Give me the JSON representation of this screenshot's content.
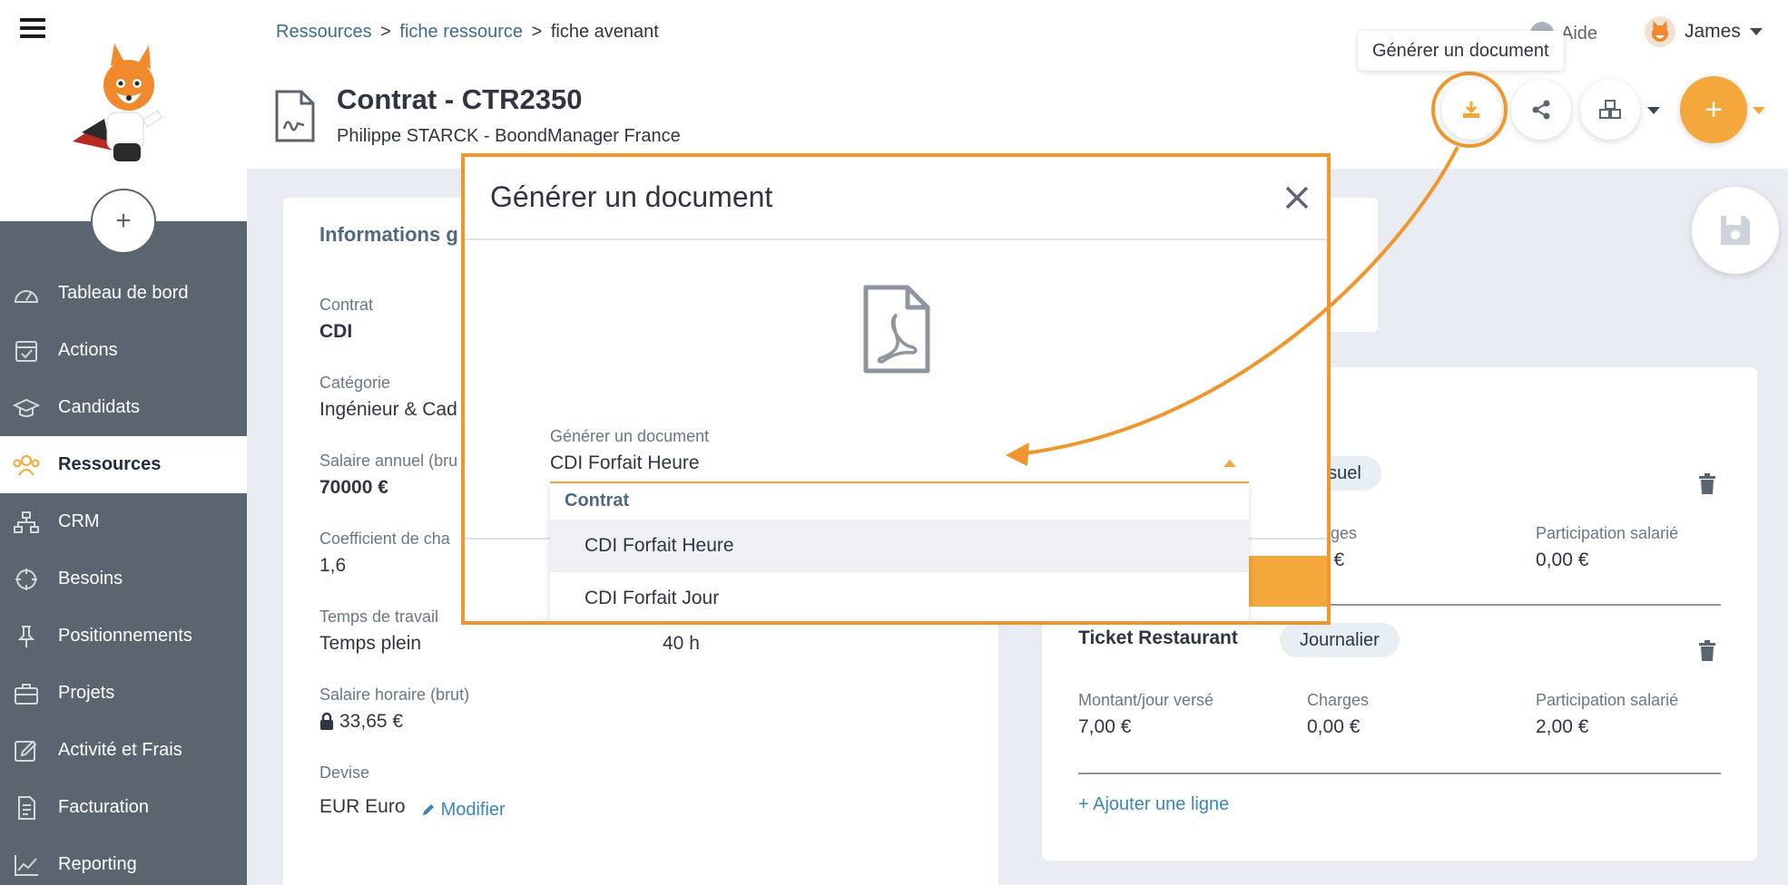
{
  "sidebar": {
    "items": [
      {
        "label": "Tableau de bord",
        "icon": "dashboard-icon"
      },
      {
        "label": "Actions",
        "icon": "calendar-check-icon"
      },
      {
        "label": "Candidats",
        "icon": "graduation-cap-icon"
      },
      {
        "label": "Ressources",
        "icon": "users-icon",
        "active": true
      },
      {
        "label": "CRM",
        "icon": "sitemap-icon"
      },
      {
        "label": "Besoins",
        "icon": "crosshair-icon"
      },
      {
        "label": "Positionnements",
        "icon": "pin-icon"
      },
      {
        "label": "Projets",
        "icon": "briefcase-icon"
      },
      {
        "label": "Activité et Frais",
        "icon": "edit-icon"
      },
      {
        "label": "Facturation",
        "icon": "invoice-icon"
      },
      {
        "label": "Reporting",
        "icon": "chart-line-icon"
      }
    ],
    "add_label": "+"
  },
  "breadcrumb": {
    "items": [
      "Ressources",
      "fiche ressource"
    ],
    "current": "fiche avenant",
    "separator": ">"
  },
  "header": {
    "title": "Contrat - CTR2350",
    "subtitle": "Philippe STARCK - BoondManager France",
    "help": "Aide",
    "user": "James",
    "tooltip": "Générer un document",
    "plus": "+"
  },
  "left_card": {
    "section_title": "Informations g",
    "fields": [
      {
        "label": "Contrat",
        "value": "CDI"
      },
      {
        "label": "Catégorie",
        "value": "Ingénieur & Cad"
      },
      {
        "label": "Salaire annuel (bru",
        "value": "70000 €"
      },
      {
        "label": "Coefficient de cha",
        "value": "1,6"
      },
      {
        "label": "Temps de travail",
        "value": "Temps plein",
        "extra": "40 h"
      },
      {
        "label": "Salaire horaire (brut)",
        "value": "33,65 €"
      },
      {
        "label": "Devise",
        "value": "EUR Euro",
        "link": "Modifier"
      }
    ]
  },
  "right_card": {
    "row1": {
      "pill": "nsuel",
      "charges_label": "harges",
      "charges_value": "0 €",
      "participation_label": "Participation salarié",
      "participation_value": "0,00 €"
    },
    "row2": {
      "name": "Ticket Restaurant",
      "pill": "Journalier",
      "montant_label": "Montant/jour versé",
      "montant_value": "7,00 €",
      "charges_label": "Charges",
      "charges_value": "0,00 €",
      "participation_label": "Participation salarié",
      "participation_value": "2,00 €"
    },
    "add_line": "+ Ajouter une ligne"
  },
  "modal": {
    "title": "Générer un document",
    "field_label": "Générer un document",
    "field_value": "CDI Forfait Heure",
    "group_label": "Contrat",
    "options": [
      "CDI Forfait Heure",
      "CDI Forfait Jour"
    ],
    "selected_option": "CDI Forfait Heure"
  },
  "colors": {
    "accent": "#f4a73a",
    "highlight": "#f0962e",
    "sidebar": "#5b6570",
    "link": "#3b86b5"
  }
}
